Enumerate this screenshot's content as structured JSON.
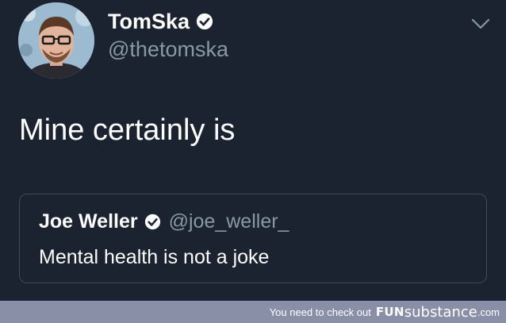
{
  "tweet": {
    "author": {
      "display_name": "TomSka",
      "handle": "@thetomska",
      "verified": true
    },
    "text": "Mine certainly is",
    "quoted_tweet": {
      "author": {
        "display_name": "Joe Weller",
        "handle": "@joe_weller_",
        "verified": true
      },
      "text": "Mental health is not a joke"
    }
  },
  "footer": {
    "text": "You need to check out",
    "brand_part1": "FUN",
    "brand_part2": "substance",
    "brand_tld": ".com"
  },
  "icons": {
    "verified": "verified-badge-icon",
    "caret": "chevron-down-icon"
  },
  "colors": {
    "background": "#1b2330",
    "secondary_text": "#8899a6",
    "quote_border": "#3d4a5a",
    "footer_background": "#8a8fa8"
  }
}
